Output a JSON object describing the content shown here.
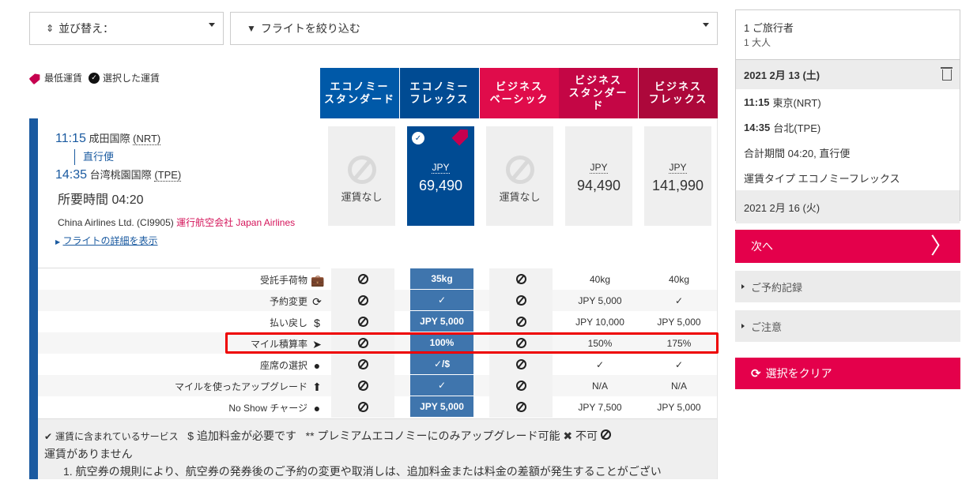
{
  "toolbar": {
    "sort_label": "並び替え：",
    "filter_label": "フライトを絞り込む"
  },
  "legend": {
    "lowest_fare": "最低運賃",
    "selected_fare": "選択した運賃"
  },
  "fare_columns": [
    {
      "label_l1": "エコノミー",
      "label_l2": "スタンダード",
      "color": "#0059a8"
    },
    {
      "label_l1": "エコノミー",
      "label_l2": "フレックス",
      "color": "#004b93"
    },
    {
      "label_l1": "ビジネス",
      "label_l2": "ベーシック",
      "color": "#e00c4b"
    },
    {
      "label_l1": "ビジネス",
      "label_l2": "スタンダード",
      "color": "#c40645"
    },
    {
      "label_l1": "ビジネス",
      "label_l2": "フレックス",
      "color": "#ad083b"
    }
  ],
  "flight": {
    "dep_time": "11:15",
    "dep_airport": "成田国際",
    "dep_code": "(NRT)",
    "direct": "直行便",
    "arr_time": "14:35",
    "arr_airport": "台湾桃園国際",
    "arr_code": "(TPE)",
    "duration": "所要時間 04:20",
    "carrier": "China Airlines Ltd. (CI9905)",
    "operated_by": "運行航空会社 Japan Airlines",
    "details_link": "フライトの詳細を表示"
  },
  "fares": [
    {
      "available": false,
      "label": "運賃なし"
    },
    {
      "available": true,
      "currency": "JPY",
      "amount": "69,490",
      "selected": true,
      "lowest": true
    },
    {
      "available": false,
      "label": "運賃なし"
    },
    {
      "available": true,
      "currency": "JPY",
      "amount": "94,490"
    },
    {
      "available": true,
      "currency": "JPY",
      "amount": "141,990"
    }
  ],
  "benefits": [
    {
      "label": "受託手荷物",
      "icon": "briefcase-icon",
      "values": [
        "none",
        "35kg",
        "none",
        "40kg",
        "40kg"
      ]
    },
    {
      "label": "予約変更",
      "icon": "refresh-icon",
      "values": [
        "none",
        "✓",
        "none",
        "JPY 5,000",
        "✓"
      ]
    },
    {
      "label": "払い戻し",
      "icon": "refund-icon",
      "values": [
        "none",
        "JPY 5,000",
        "none",
        "JPY 10,000",
        "JPY 5,000"
      ]
    },
    {
      "label": "マイル積算率",
      "icon": "paper-plane-icon",
      "values": [
        "none",
        "100%",
        "none",
        "150%",
        "175%"
      ]
    },
    {
      "label": "座席の選択",
      "icon": "user-icon",
      "values": [
        "none",
        "✓/$",
        "none",
        "✓",
        "✓"
      ]
    },
    {
      "label": "マイルを使ったアップグレード",
      "icon": "upgrade-icon",
      "values": [
        "none",
        "✓",
        "none",
        "N/A",
        "N/A"
      ]
    },
    {
      "label": "No Show チャージ",
      "icon": "user-icon",
      "values": [
        "none",
        "JPY 5,000",
        "none",
        "JPY 7,500",
        "JPY 5,000"
      ]
    }
  ],
  "footnote": {
    "included": "運賃に含まれているサービス",
    "extra": "追加料金が必要です",
    "premium": "** プレミアムエコノミーにのみアップグレード可能",
    "not_allowed": "不可",
    "no_fare": "運賃がありません",
    "rule_1": "1. 航空券の規則により、航空券の発券後のご予約の変更や取消しは、追加料金または料金の差額が発生することがござい"
  },
  "summary": {
    "travelers": "1 ご旅行者",
    "adults": "1 大人",
    "outbound_date": "2021 2月 13 (土)",
    "dep_time": "11:15",
    "dep_city": "東京(NRT)",
    "arr_time": "14:35",
    "arr_city": "台北(TPE)",
    "total_duration": "合計期間 04:20, 直行便",
    "fare_type": "運賃タイプ エコノミーフレックス",
    "return_date": "2021 2月 16 (火)"
  },
  "sidebar": {
    "next_label": "次へ",
    "booking_record": "ご予約記録",
    "notice": "ご注意",
    "clear_label": "選択をクリア"
  },
  "colors": {
    "accent_red": "#e4004b",
    "brand_blue": "#004b93",
    "highlight": "#ee0000"
  }
}
